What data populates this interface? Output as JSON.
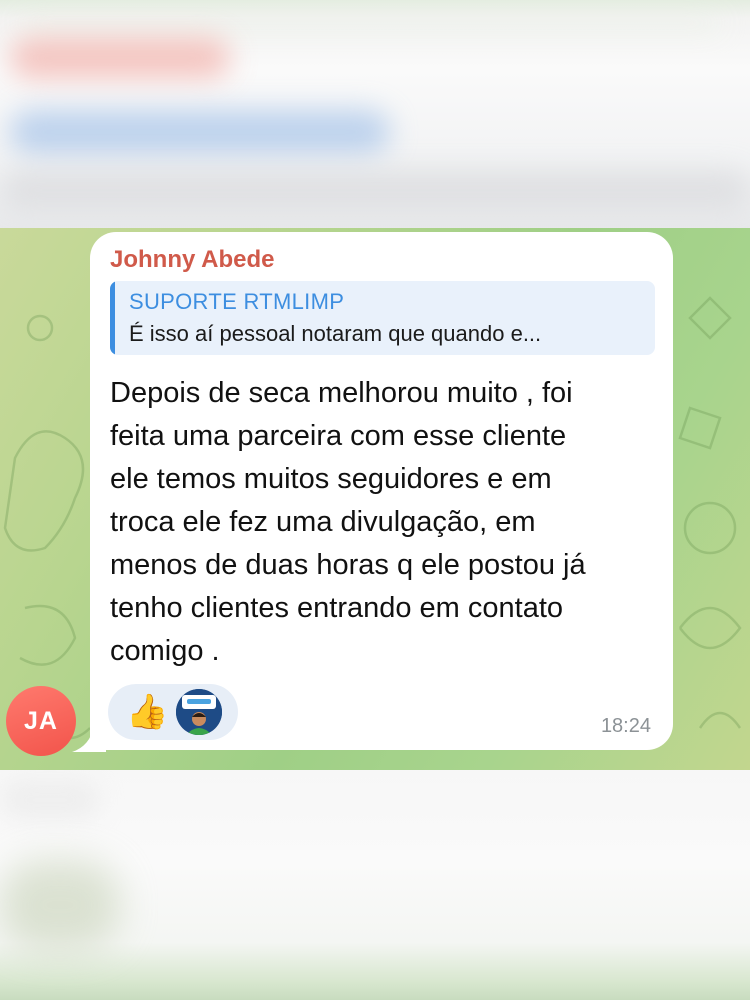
{
  "chat": {
    "message": {
      "sender_name": "Johnny Abede",
      "reply_to": {
        "title": "SUPORTE RTMLIMP",
        "preview": "É isso aí pessoal notaram que quando e..."
      },
      "text": "Depois de seca melhorou muito , foi\nfeita uma parceira com esse cliente\nele temos muitos seguidores e em\ntroca ele fez uma divulgação, em\nmenos de duas horas q ele postou já\ntenho clientes entrando em contato\ncomigo .",
      "time": "18:24",
      "reactions": [
        {
          "emoji": "👍",
          "icon": "thumbs-up-icon"
        },
        {
          "icon": "reactor-avatar"
        }
      ]
    },
    "avatar_initials": "JA"
  },
  "colors": {
    "sender": "#d05a4a",
    "reply_accent": "#3d8ee0",
    "avatar": "#f2544b",
    "chat_background": "#a8d48d"
  }
}
